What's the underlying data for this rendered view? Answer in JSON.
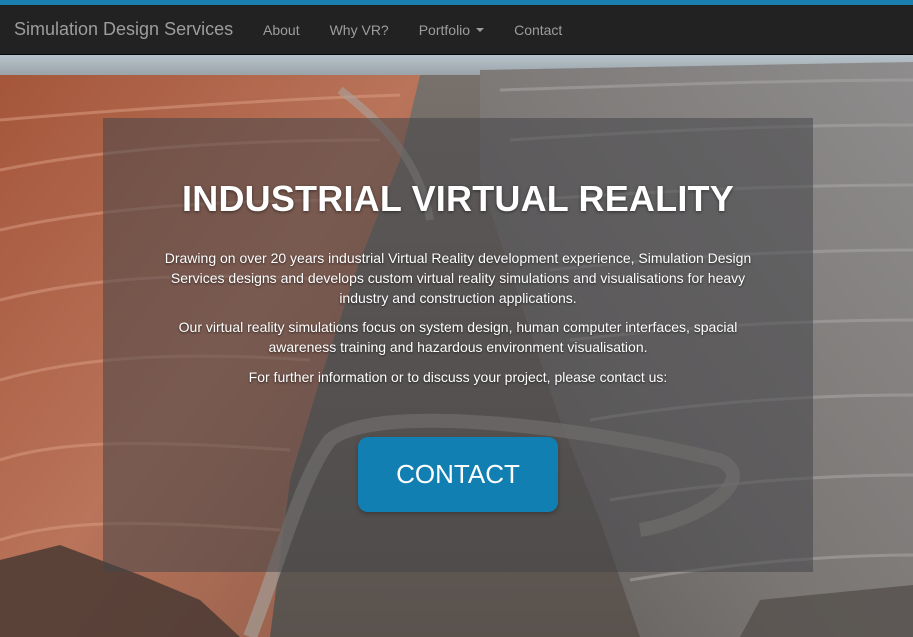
{
  "navbar": {
    "brand": "Simulation Design Services",
    "items": [
      {
        "label": "About"
      },
      {
        "label": "Why VR?"
      },
      {
        "label": "Portfolio",
        "has_dropdown": true
      },
      {
        "label": "Contact"
      }
    ]
  },
  "hero": {
    "title": "INDUSTRIAL VIRTUAL REALITY",
    "paragraphs": [
      "Drawing on over 20 years industrial Virtual Reality development experience, Simulation Design Services designs and develops custom virtual reality simulations and visualisations for heavy industry and construction applications.",
      "Our virtual reality simulations focus on system design, human computer interfaces, spacial awareness training and hazardous environment visualisation.",
      "For further information or to discuss your project, please contact us:"
    ],
    "button_label": "CONTACT"
  },
  "colors": {
    "accent": "#1a7fae",
    "navbar_bg": "#222222",
    "nav_text": "#9d9d9d",
    "button_bg": "#127fb2",
    "overlay": "rgba(70,70,72,0.55)"
  },
  "icons": {
    "dropdown": "caret-down-icon"
  }
}
